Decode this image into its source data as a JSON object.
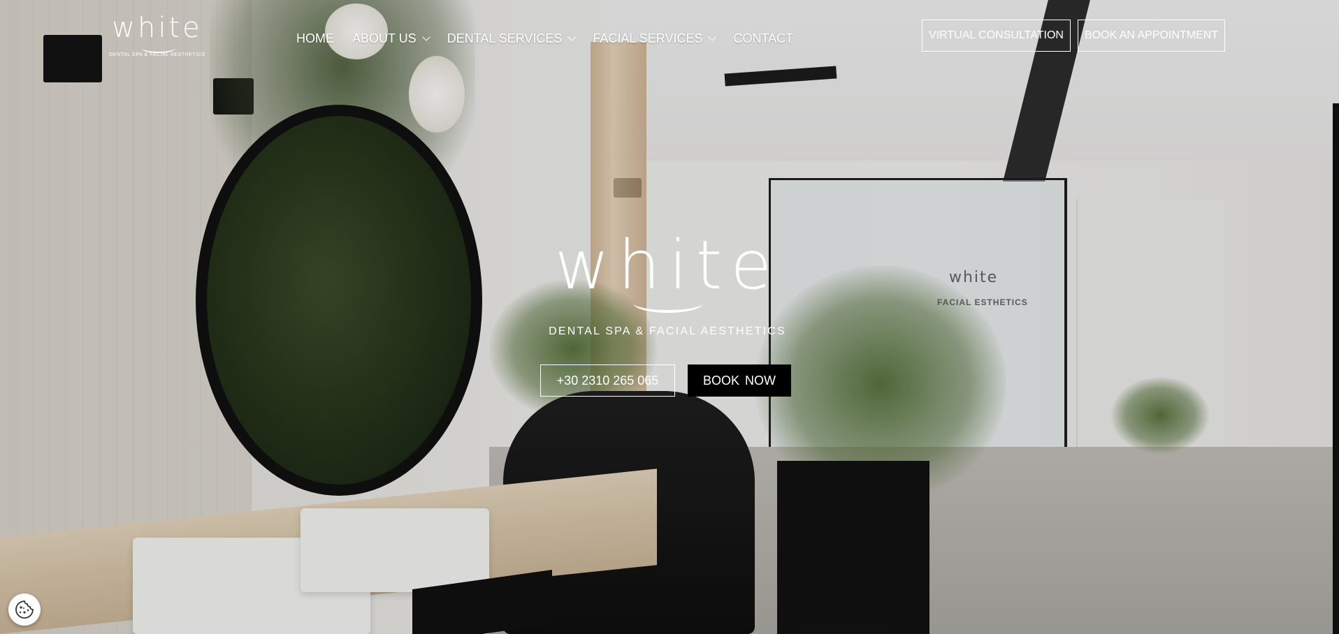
{
  "brand": {
    "logo_word": "white",
    "logo_tagline": "DENTAL SPA & FACIAL AESTHETICS"
  },
  "nav": {
    "items": [
      {
        "label": "HOME",
        "has_dropdown": false
      },
      {
        "label": "ABOUT US",
        "has_dropdown": true
      },
      {
        "label": "DENTAL SERVICES",
        "has_dropdown": true
      },
      {
        "label": "FACIAL SERVICES",
        "has_dropdown": true
      },
      {
        "label": "CONTACT",
        "has_dropdown": false
      }
    ]
  },
  "header_buttons": {
    "virtual_consultation": "VIRTUAL CONSULTATION",
    "book_appointment": "BOOK AN APPOINTMENT"
  },
  "hero": {
    "logo_word": "white",
    "tagline": "DENTAL SPA & FACIAL AESTHETICS",
    "phone": "+30 2310 265 065",
    "book_now": "BOOK NOW"
  },
  "scene_text": {
    "glass_logo": "white",
    "glass_label": "FACIAL ESTHETICS"
  },
  "icons": {
    "cookie": "cookie-icon",
    "dropdown": "chevron-down-icon"
  },
  "colors": {
    "text_on_hero": "#ffffff",
    "book_now_bg": "#000000"
  }
}
